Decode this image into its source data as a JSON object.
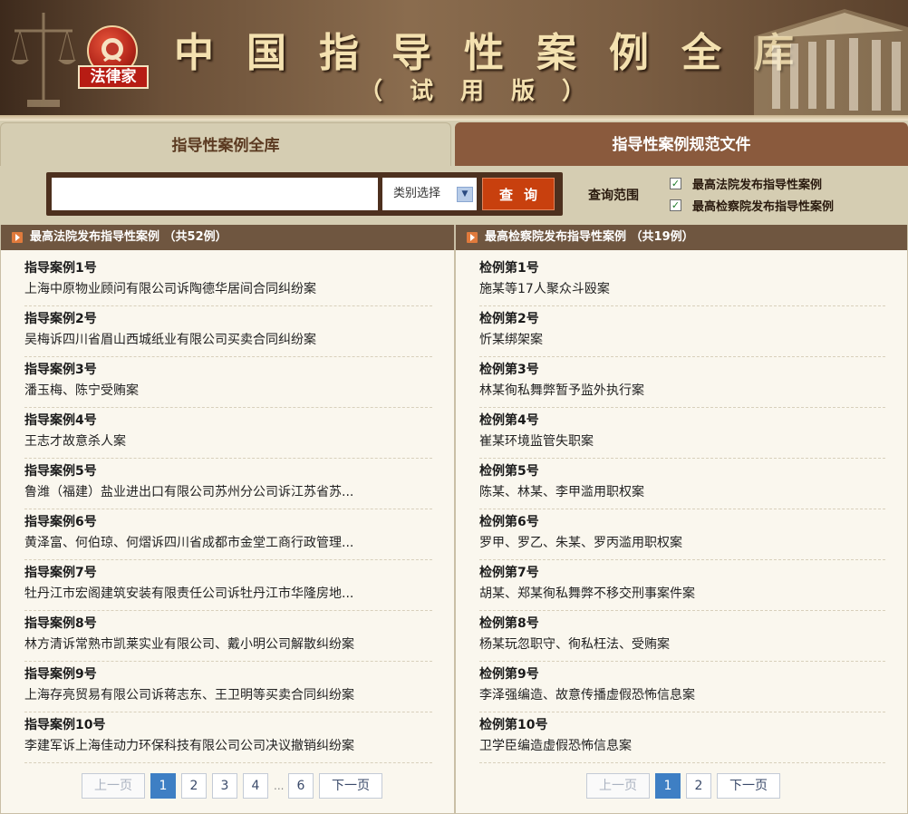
{
  "banner": {
    "logo_text": "法律家",
    "title": "中国指导性案例全库",
    "subtitle": "（试用版）"
  },
  "tabs": [
    {
      "label": "指导性案例全库",
      "active": true
    },
    {
      "label": "指导性案例规范文件",
      "active": false
    }
  ],
  "search": {
    "input_value": "",
    "category_select": "类别选择",
    "query_button": "查询",
    "scope_label": "查询范围",
    "scopes": [
      {
        "label": "最高法院发布指导性案例",
        "checked": true
      },
      {
        "label": "最高检察院发布指导性案例",
        "checked": true
      }
    ]
  },
  "left_column": {
    "header": "最高法院发布指导性案例 （共52例）",
    "items": [
      {
        "num": "指导案例1号",
        "title": "上海中原物业顾问有限公司诉陶德华居间合同纠纷案"
      },
      {
        "num": "指导案例2号",
        "title": "吴梅诉四川省眉山西城纸业有限公司买卖合同纠纷案"
      },
      {
        "num": "指导案例3号",
        "title": "潘玉梅、陈宁受贿案"
      },
      {
        "num": "指导案例4号",
        "title": "王志才故意杀人案"
      },
      {
        "num": "指导案例5号",
        "title": "鲁潍（福建）盐业进出口有限公司苏州分公司诉江苏省苏..."
      },
      {
        "num": "指导案例6号",
        "title": "黄泽富、何伯琼、何熠诉四川省成都市金堂工商行政管理..."
      },
      {
        "num": "指导案例7号",
        "title": "牡丹江市宏阁建筑安装有限责任公司诉牡丹江市华隆房地..."
      },
      {
        "num": "指导案例8号",
        "title": "林方清诉常熟市凯莱实业有限公司、戴小明公司解散纠纷案"
      },
      {
        "num": "指导案例9号",
        "title": "上海存亮贸易有限公司诉蒋志东、王卫明等买卖合同纠纷案"
      },
      {
        "num": "指导案例10号",
        "title": "李建军诉上海佳动力环保科技有限公司公司决议撤销纠纷案"
      }
    ],
    "pager": {
      "prev": "上一页",
      "pages": [
        "1",
        "2",
        "3",
        "4"
      ],
      "ellipsis": "...",
      "last": "6",
      "next": "下一页",
      "current": "1"
    }
  },
  "right_column": {
    "header": "最高检察院发布指导性案例 （共19例）",
    "items": [
      {
        "num": "检例第1号",
        "title": "施某等17人聚众斗殴案"
      },
      {
        "num": "检例第2号",
        "title": "忻某绑架案"
      },
      {
        "num": "检例第3号",
        "title": "林某徇私舞弊暂予监外执行案"
      },
      {
        "num": "检例第4号",
        "title": "崔某环境监管失职案"
      },
      {
        "num": "检例第5号",
        "title": "陈某、林某、李甲滥用职权案"
      },
      {
        "num": "检例第6号",
        "title": "罗甲、罗乙、朱某、罗丙滥用职权案"
      },
      {
        "num": "检例第7号",
        "title": "胡某、郑某徇私舞弊不移交刑事案件案"
      },
      {
        "num": "检例第8号",
        "title": "杨某玩忽职守、徇私枉法、受贿案"
      },
      {
        "num": "检例第9号",
        "title": "李泽强编造、故意传播虚假恐怖信息案"
      },
      {
        "num": "检例第10号",
        "title": "卫学臣编造虚假恐怖信息案"
      }
    ],
    "pager": {
      "prev": "上一页",
      "pages": [
        "1",
        "2"
      ],
      "next": "下一页",
      "current": "1"
    }
  }
}
